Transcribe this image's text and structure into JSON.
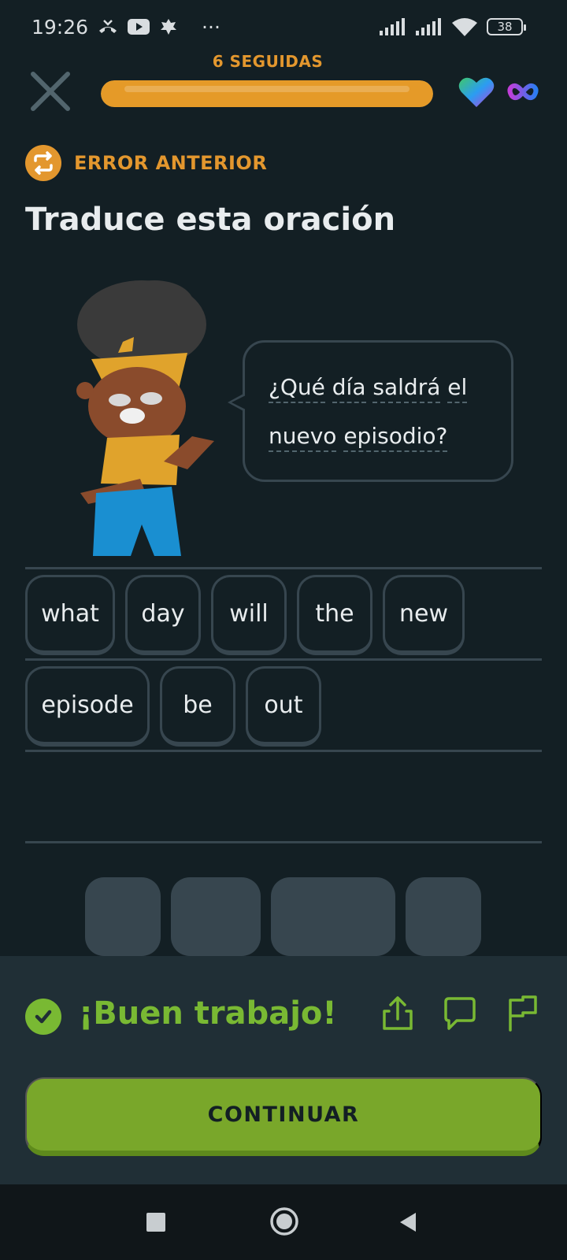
{
  "status_bar": {
    "time": "19:26",
    "extra": "···",
    "battery": "38",
    "icons": [
      "missed-call-icon",
      "youtube-icon",
      "leaf-icon",
      "signal-icon",
      "signal-icon",
      "wifi-icon",
      "battery-icon"
    ]
  },
  "header": {
    "streak_label": "6 SEGUIDAS",
    "progress": 1.0,
    "progress_color": "#e59a28",
    "icons": [
      "close-icon",
      "heart-icon",
      "infinity-icon"
    ]
  },
  "lesson": {
    "error_label": "ERROR ANTERIOR",
    "title": "Traduce esta oración",
    "sentence_words_line1": [
      "¿Qué",
      "día",
      "saldrá",
      "el"
    ],
    "sentence_words_line2": [
      "nuevo",
      "episodio?"
    ]
  },
  "answer_tiles": [
    "what",
    "day",
    "will",
    "the",
    "new",
    "episode",
    "be",
    "out"
  ],
  "word_bank_slots": 4,
  "feedback": {
    "message": "¡Buen trabajo!",
    "continue_label": "CONTINUAR",
    "color": "#79b933",
    "icons": [
      "share-icon",
      "comment-icon",
      "flag-icon"
    ]
  }
}
